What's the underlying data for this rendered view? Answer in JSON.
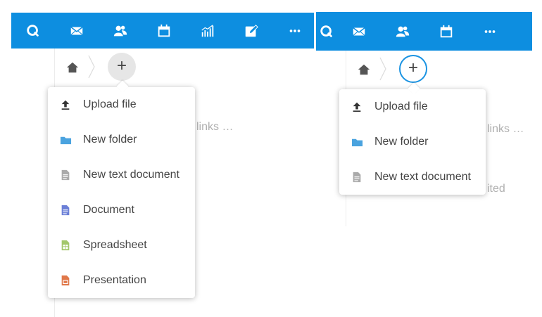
{
  "colors": {
    "topbar": "#0d8ee0",
    "folder": "#4aa3df",
    "document": "#6b7fd7",
    "spreadsheet": "#a3c76b",
    "presentation": "#e0784a",
    "textdoc": "#aaaaaa"
  },
  "left": {
    "topbar_icons": [
      "search-icon",
      "mail-icon",
      "contacts-icon",
      "calendar-icon",
      "activity-icon",
      "notes-icon",
      "more-icon"
    ],
    "menu": [
      {
        "label": "Upload file",
        "icon": "upload-icon"
      },
      {
        "label": "New folder",
        "icon": "folder-icon"
      },
      {
        "label": "New text document",
        "icon": "text-document-icon"
      },
      {
        "label": "Document",
        "icon": "document-icon"
      },
      {
        "label": "Spreadsheet",
        "icon": "spreadsheet-icon"
      },
      {
        "label": "Presentation",
        "icon": "presentation-icon"
      }
    ],
    "background_text": "links …"
  },
  "right": {
    "topbar_icons": [
      "search-icon",
      "mail-icon",
      "contacts-icon",
      "calendar-icon",
      "more-icon"
    ],
    "menu": [
      {
        "label": "Upload file",
        "icon": "upload-icon"
      },
      {
        "label": "New folder",
        "icon": "folder-icon"
      },
      {
        "label": "New text document",
        "icon": "text-document-icon"
      }
    ],
    "background_text_1": "links …",
    "background_text_2": "ited"
  },
  "plus_label": "+"
}
